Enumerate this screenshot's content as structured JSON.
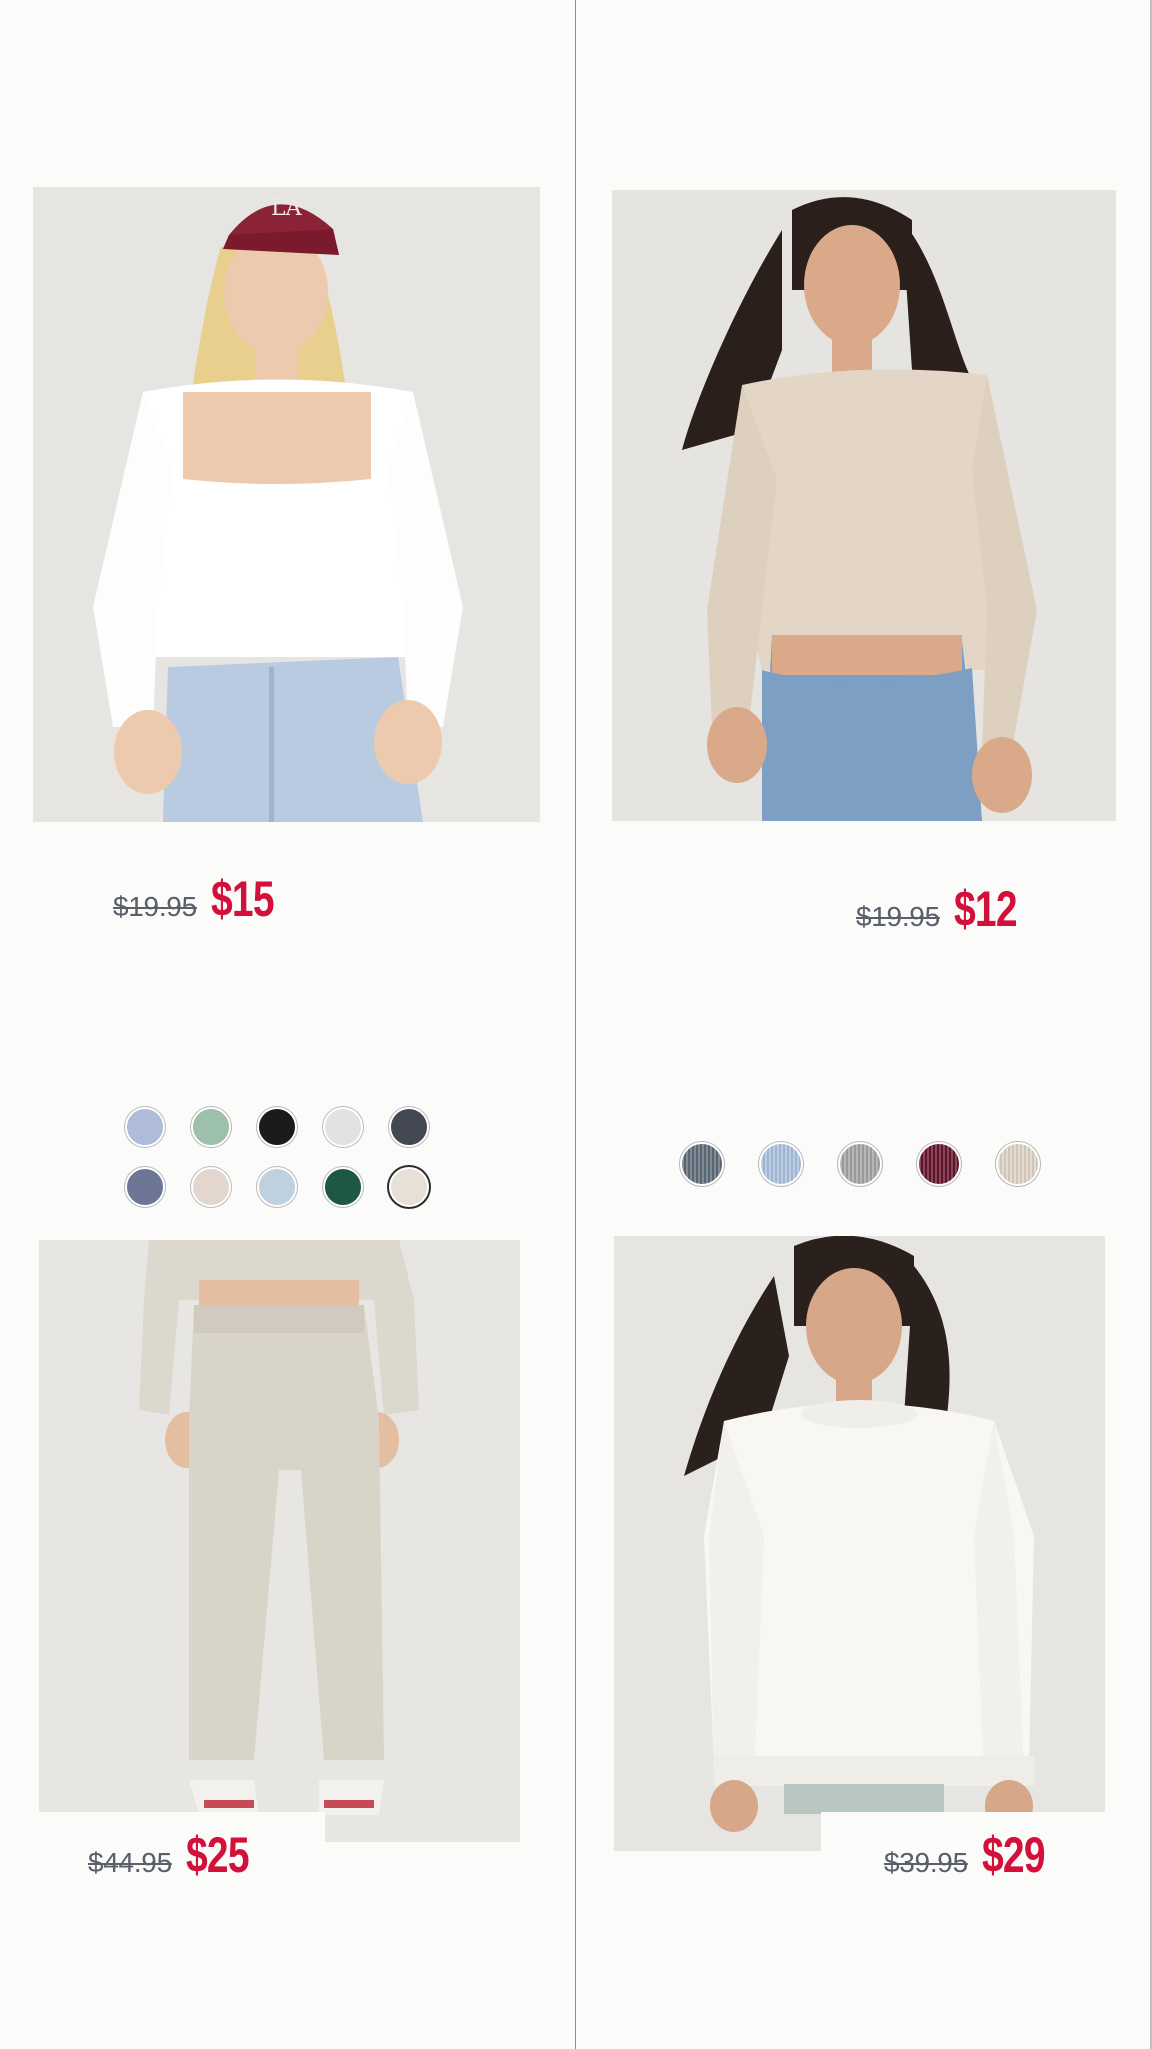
{
  "products": [
    {
      "image_label": "White square neck long sleeve top",
      "original_price": "$19.95",
      "sale_price": "$15",
      "swatches": [
        {
          "color": "#aebbd9",
          "selected": false,
          "ribbed": false
        },
        {
          "color": "#9cc0a9",
          "selected": false,
          "ribbed": false
        },
        {
          "color": "#1b1b1b",
          "selected": false,
          "ribbed": false
        },
        {
          "color": "#e2e2e2",
          "selected": false,
          "ribbed": false
        },
        {
          "color": "#444853",
          "selected": false,
          "ribbed": false
        },
        {
          "color": "#6d7695",
          "selected": false,
          "ribbed": false
        },
        {
          "color": "#e3d6ce",
          "selected": false,
          "ribbed": false
        },
        {
          "color": "#bfd1de",
          "selected": false,
          "ribbed": false
        },
        {
          "color": "#1f5747",
          "selected": false,
          "ribbed": false
        },
        {
          "color": "#e6e0d7",
          "selected": true,
          "ribbed": false
        }
      ]
    },
    {
      "image_label": "Oatmeal ribbed long sleeve crew tee",
      "original_price": "$19.95",
      "sale_price": "$12",
      "swatches": [
        {
          "color": "#5f6c79",
          "selected": false,
          "ribbed": true
        },
        {
          "color": "#a9c0dc",
          "selected": false,
          "ribbed": true
        },
        {
          "color": "#a3a3a3",
          "selected": false,
          "ribbed": true
        },
        {
          "color": "#64142c",
          "selected": false,
          "ribbed": true
        },
        {
          "color": "#dcd2c3",
          "selected": false,
          "ribbed": true
        }
      ]
    },
    {
      "image_label": "Light taupe fleece joggers",
      "original_price": "$44.95",
      "sale_price": "$25",
      "swatches": []
    },
    {
      "image_label": "Cream oversized crew sweater",
      "original_price": "$39.95",
      "sale_price": "$29",
      "swatches": []
    }
  ],
  "colors": {
    "sale_price": "#d3103a",
    "original_price": "#5b5f6a",
    "background": "#fbfbfa",
    "divider": "#8e8e8e"
  }
}
